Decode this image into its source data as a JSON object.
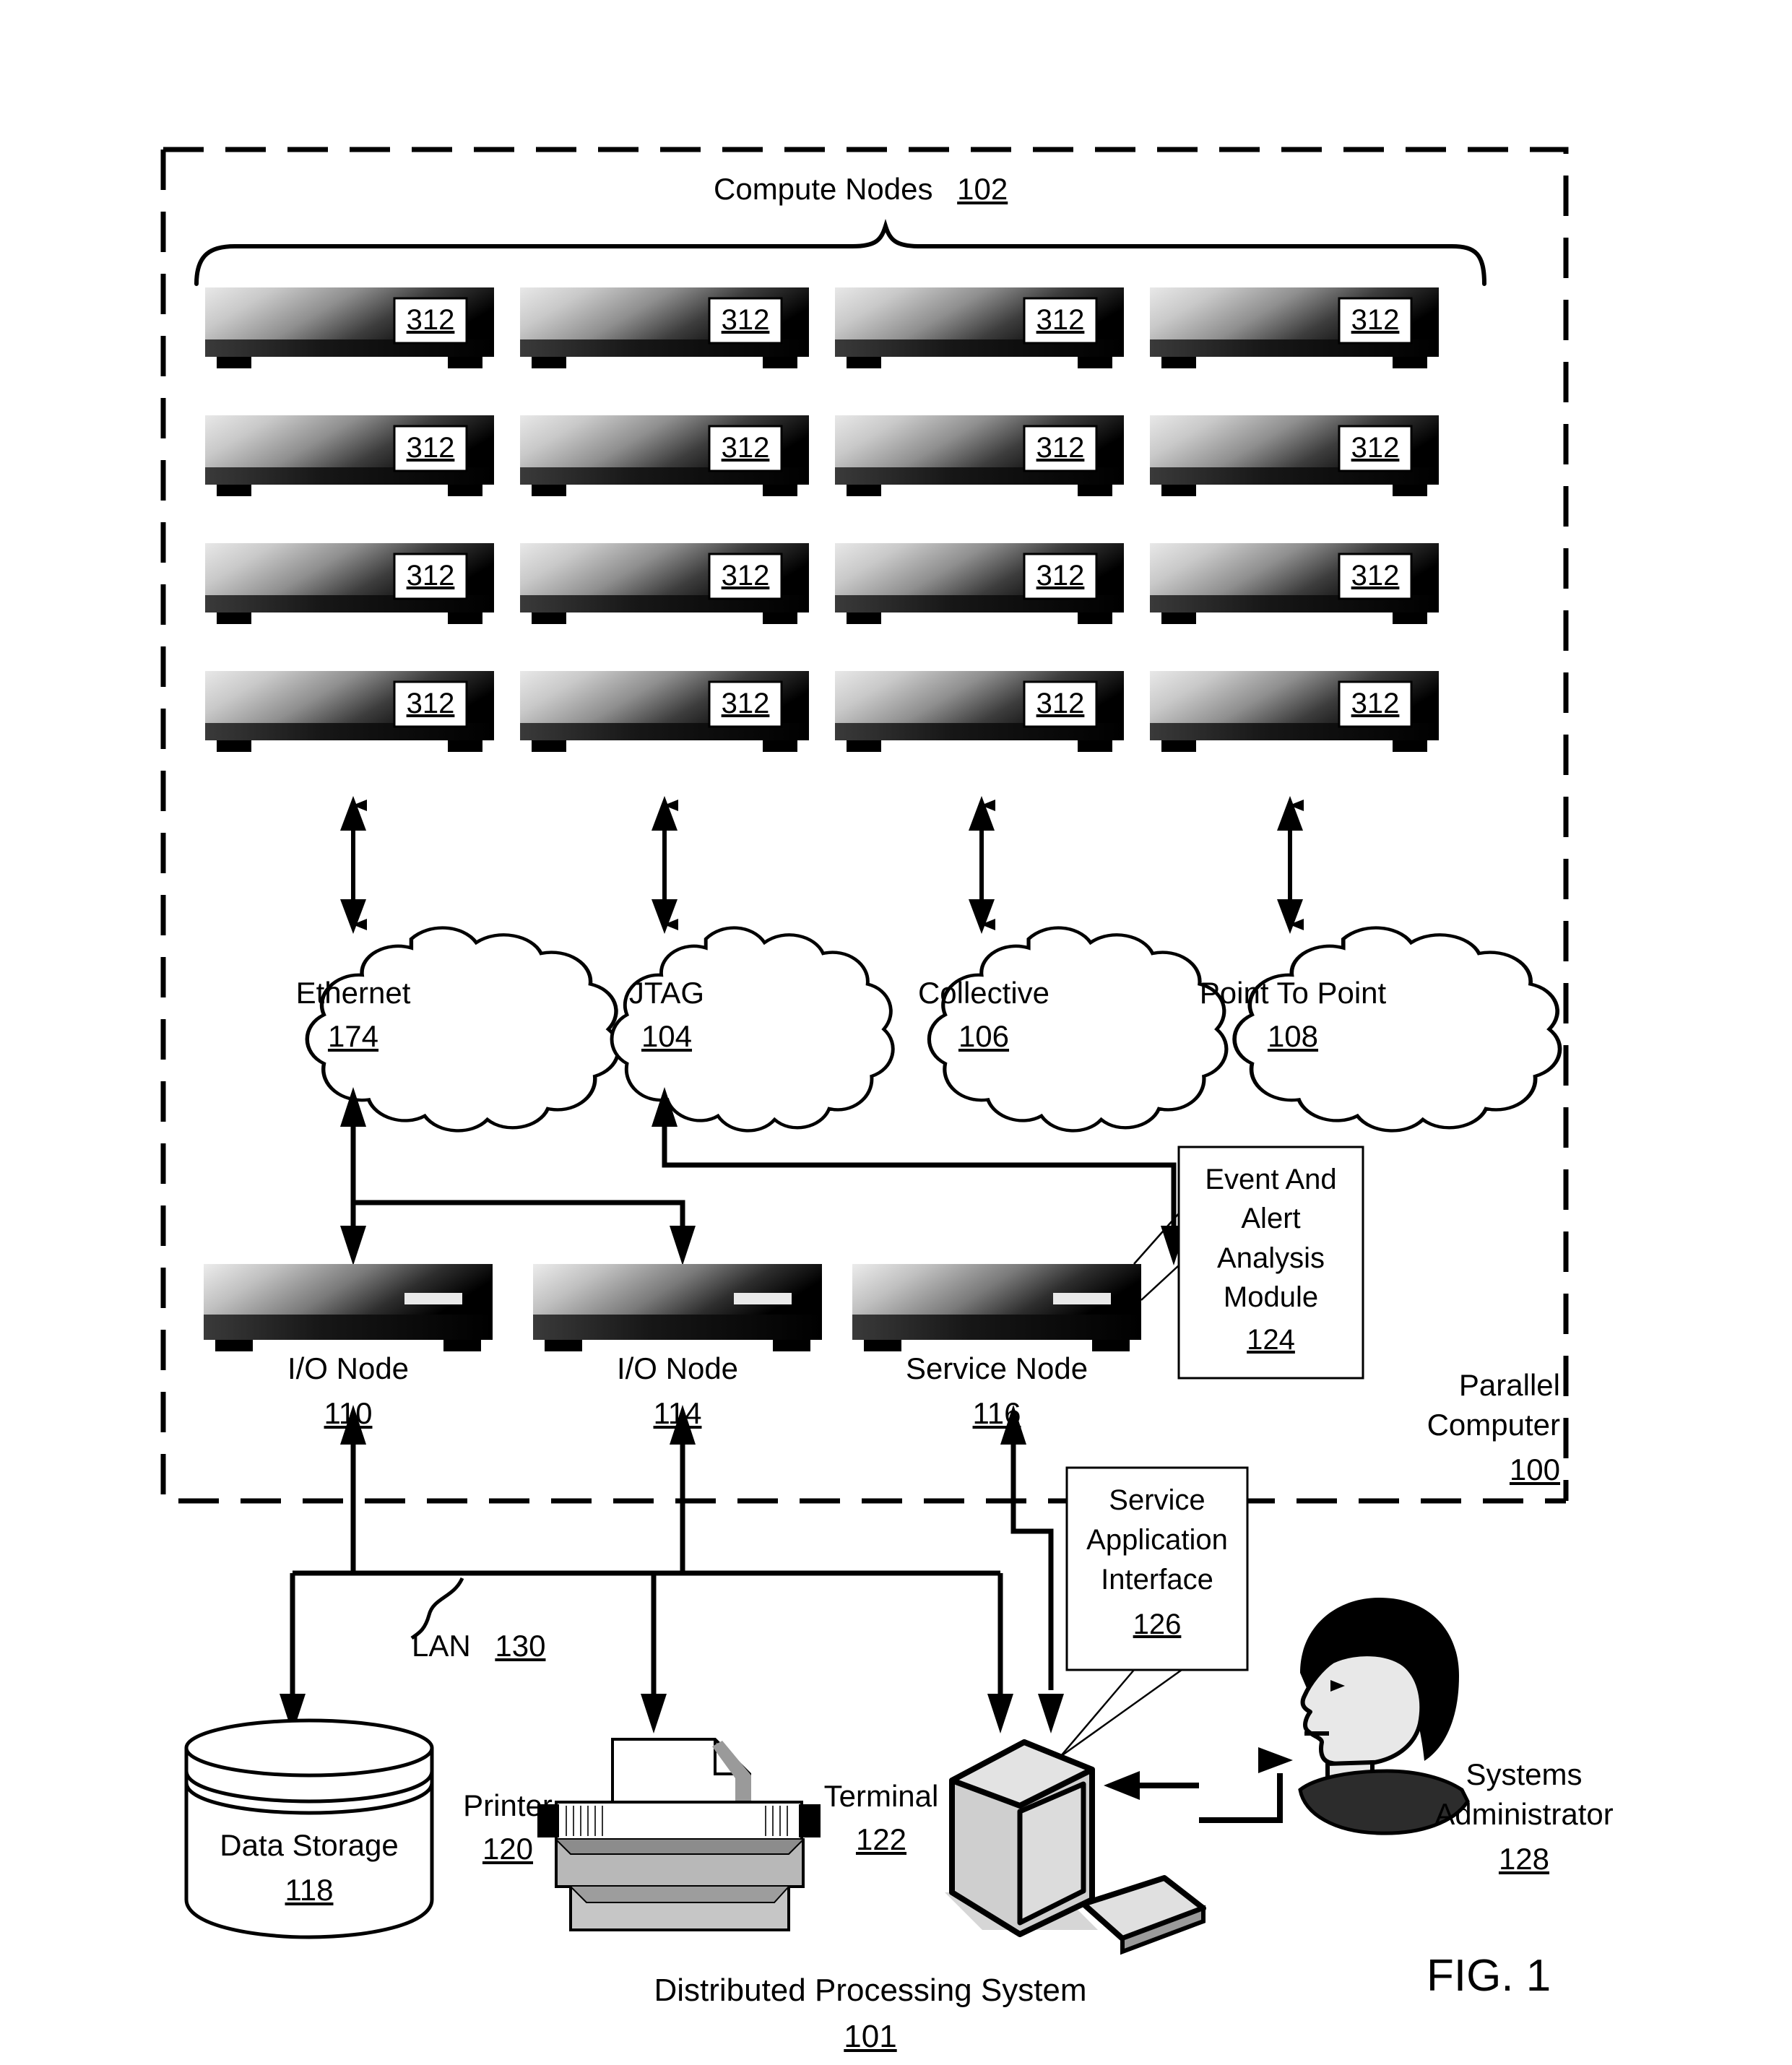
{
  "figure": {
    "label": "FIG. 1",
    "caption_title": "Distributed Processing System",
    "caption_ref": "101"
  },
  "parallel_computer": {
    "label_line1": "Parallel",
    "label_line2": "Computer",
    "ref": "100"
  },
  "compute_nodes": {
    "title": "Compute Nodes",
    "ref": "102",
    "node_label": "312",
    "rows": 4,
    "cols": 4,
    "nodes": [
      {
        "label": "312"
      },
      {
        "label": "312"
      },
      {
        "label": "312"
      },
      {
        "label": "312"
      },
      {
        "label": "312"
      },
      {
        "label": "312"
      },
      {
        "label": "312"
      },
      {
        "label": "312"
      },
      {
        "label": "312"
      },
      {
        "label": "312"
      },
      {
        "label": "312"
      },
      {
        "label": "312"
      },
      {
        "label": "312"
      },
      {
        "label": "312"
      },
      {
        "label": "312"
      },
      {
        "label": "312"
      }
    ]
  },
  "networks": [
    {
      "name": "Ethernet",
      "ref": "174"
    },
    {
      "name": "JTAG",
      "ref": "104"
    },
    {
      "name": "Collective",
      "ref": "106"
    },
    {
      "name": "Point To Point",
      "ref": "108"
    }
  ],
  "service_nodes": [
    {
      "name": "I/O Node",
      "ref": "110"
    },
    {
      "name": "I/O Node",
      "ref": "114"
    },
    {
      "name": "Service Node",
      "ref": "116"
    }
  ],
  "event_alert_module": {
    "line1": "Event And",
    "line2": "Alert",
    "line3": "Analysis",
    "line4": "Module",
    "ref": "124"
  },
  "service_application_interface": {
    "line1": "Service",
    "line2": "Application",
    "line3": "Interface",
    "ref": "126"
  },
  "lan": {
    "name": "LAN",
    "ref": "130"
  },
  "peripherals": {
    "data_storage": {
      "name": "Data Storage",
      "ref": "118"
    },
    "printer": {
      "name": "Printer",
      "ref": "120"
    },
    "terminal": {
      "name": "Terminal",
      "ref": "122"
    },
    "administrator": {
      "line1": "Systems",
      "line2": "Administrator",
      "ref": "128"
    }
  },
  "colors": {
    "ink": "#000000",
    "paper": "#ffffff",
    "node_light": "#d8d8d8",
    "node_dark": "#0a0a0a",
    "shade": "#9a9a9a"
  }
}
